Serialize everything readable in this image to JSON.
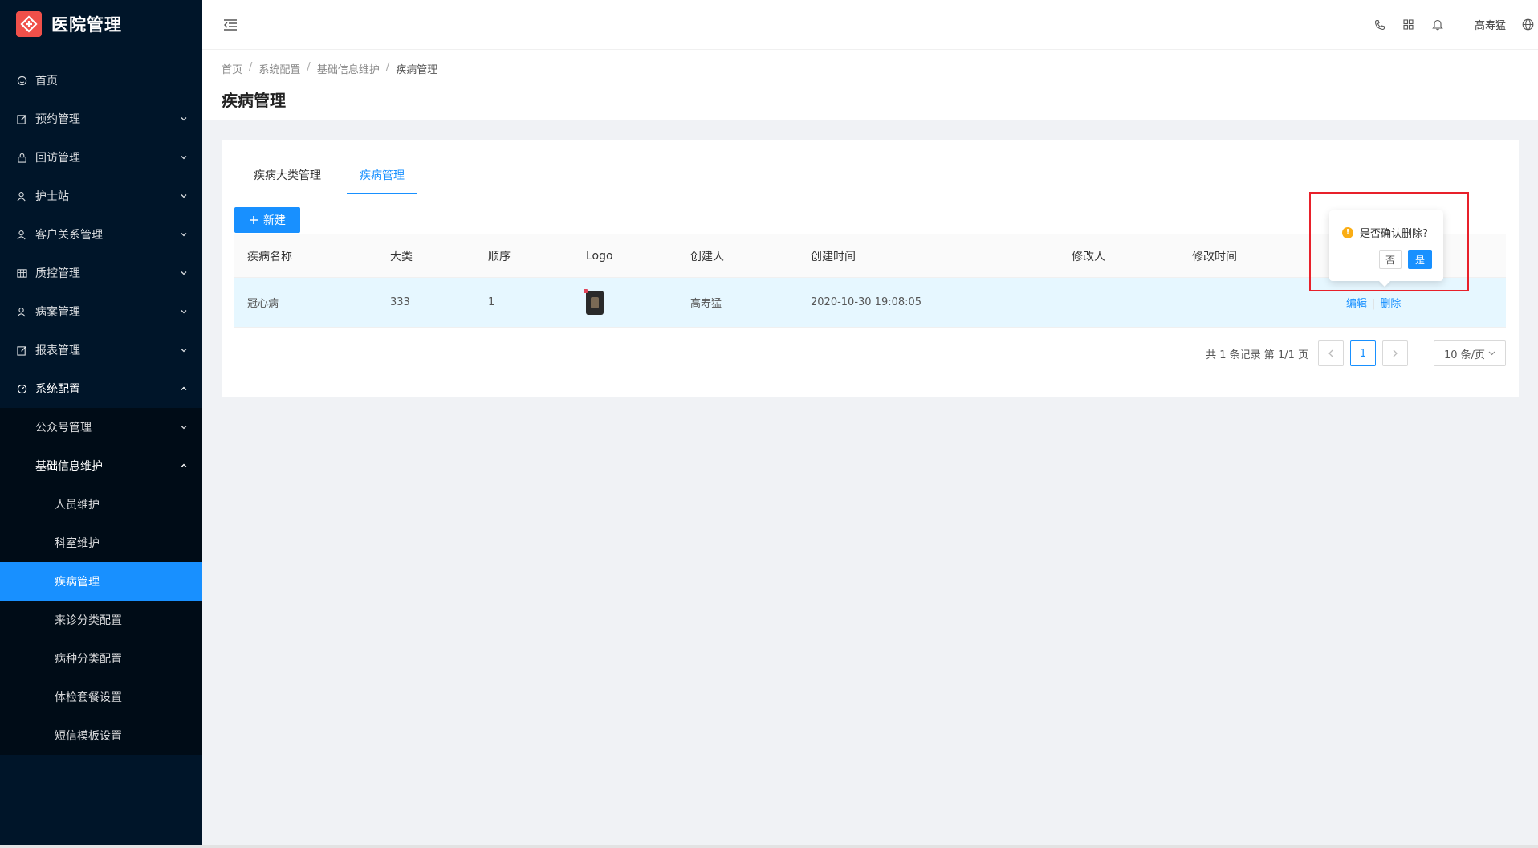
{
  "app": {
    "title": "医院管理"
  },
  "sidebar": {
    "items": [
      {
        "label": "首页",
        "icon": "home-icon"
      },
      {
        "label": "预约管理",
        "icon": "edit-icon"
      },
      {
        "label": "回访管理",
        "icon": "lock-icon"
      },
      {
        "label": "护士站",
        "icon": "user-icon"
      },
      {
        "label": "客户关系管理",
        "icon": "user-icon"
      },
      {
        "label": "质控管理",
        "icon": "table-icon"
      },
      {
        "label": "病案管理",
        "icon": "user-icon"
      },
      {
        "label": "报表管理",
        "icon": "edit-icon"
      },
      {
        "label": "系统配置",
        "icon": "dashboard-icon"
      }
    ],
    "system_sub": {
      "public_account": "公众号管理",
      "basic_info": "基础信息维护",
      "basic_info_items": [
        "人员维护",
        "科室维护",
        "疾病管理",
        "来诊分类配置",
        "病种分类配置",
        "体检套餐设置",
        "短信模板设置"
      ]
    }
  },
  "header": {
    "user_name": "高寿猛"
  },
  "breadcrumb": [
    "首页",
    "系统配置",
    "基础信息维护",
    "疾病管理"
  ],
  "page": {
    "title": "疾病管理"
  },
  "tabs": [
    "疾病大类管理",
    "疾病管理"
  ],
  "toolbar": {
    "new_label": "新建"
  },
  "table": {
    "columns": [
      "疾病名称",
      "大类",
      "顺序",
      "Logo",
      "创建人",
      "创建时间",
      "修改人",
      "修改时间"
    ],
    "rows": [
      {
        "name": "冠心病",
        "category": "333",
        "order": "1",
        "creator": "高寿猛",
        "created_at": "2020-10-30 19:08:05",
        "modifier": "",
        "modified_at": "",
        "edit": "编辑",
        "delete": "删除"
      }
    ]
  },
  "pagination": {
    "summary": "共 1 条记录 第 1/1 页",
    "current": "1",
    "page_size": "10 条/页"
  },
  "popconfirm": {
    "message": "是否确认删除?",
    "cancel": "否",
    "ok": "是"
  },
  "colors": {
    "primary": "#1890ff",
    "sidebar_bg": "#001529",
    "warning": "#faad14",
    "highlight": "#e8202a"
  }
}
